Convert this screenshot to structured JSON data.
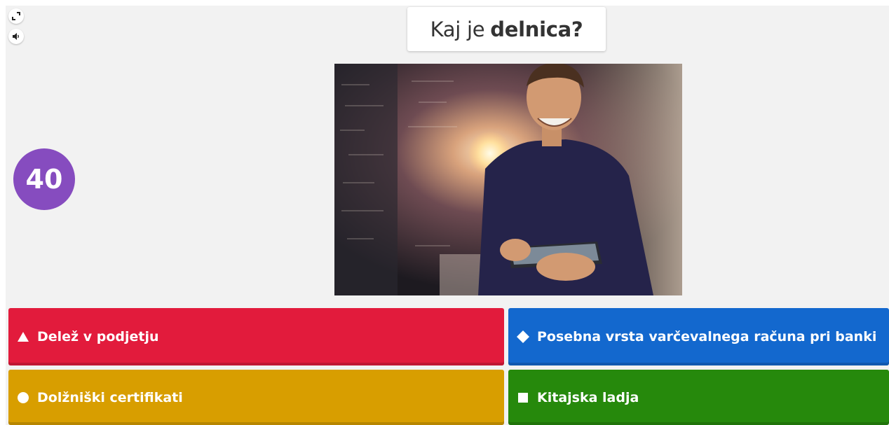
{
  "question": {
    "prefix": "Kaj je",
    "bold": "delnica?"
  },
  "timer": {
    "seconds": "40",
    "color": "#864cbf"
  },
  "controls": {
    "fullscreen_icon": "fullscreen-icon",
    "sound_icon": "speaker-icon"
  },
  "answers": [
    {
      "label": "Delež v podjetju",
      "shape": "triangle",
      "color": "#e21b3c"
    },
    {
      "label": "Posebna vrsta varčevalnega računa pri banki",
      "shape": "diamond",
      "color": "#1368ce"
    },
    {
      "label": "Dolžniški certifikati",
      "shape": "circle",
      "color": "#d89e00"
    },
    {
      "label": "Kitajska ladja",
      "shape": "square",
      "color": "#26890c"
    }
  ]
}
